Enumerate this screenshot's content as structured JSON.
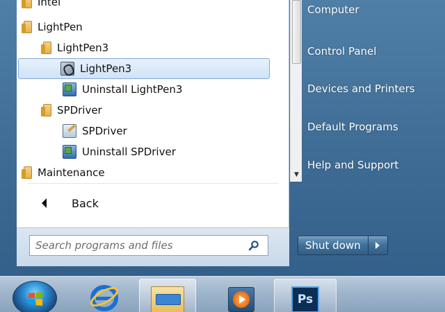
{
  "programs": {
    "items": [
      {
        "label": "Intel",
        "icon": "folder-icon"
      },
      {
        "label": "LightPen",
        "icon": "folder-icon"
      },
      {
        "label": "LightPen3",
        "icon": "folder-icon"
      },
      {
        "label": "LightPen3",
        "icon": "lightpen-app-icon",
        "selected": true
      },
      {
        "label": "Uninstall LightPen3",
        "icon": "uninstall-icon"
      },
      {
        "label": "SPDriver",
        "icon": "folder-icon"
      },
      {
        "label": "SPDriver",
        "icon": "spdriver-app-icon"
      },
      {
        "label": "Uninstall SPDriver",
        "icon": "uninstall-icon"
      },
      {
        "label": "Maintenance",
        "icon": "folder-icon"
      }
    ],
    "back_label": "Back"
  },
  "search": {
    "placeholder": "Search programs and files"
  },
  "right_pane": {
    "items": [
      {
        "label": "Computer"
      },
      {
        "label": "Control Panel"
      },
      {
        "label": "Devices and Printers"
      },
      {
        "label": "Default Programs"
      },
      {
        "label": "Help and Support"
      }
    ]
  },
  "shutdown": {
    "label": "Shut down"
  },
  "taskbar": {
    "ps_label": "Ps",
    "items": [
      "start-orb-icon",
      "internet-explorer-icon",
      "file-explorer-icon",
      "media-player-icon",
      "photoshop-icon"
    ]
  },
  "colors": {
    "selection_bg": "#cfe3f7",
    "selection_border": "#86aacd",
    "menu_glass": "#3f6c95",
    "taskbar": "#9eb5cc"
  }
}
